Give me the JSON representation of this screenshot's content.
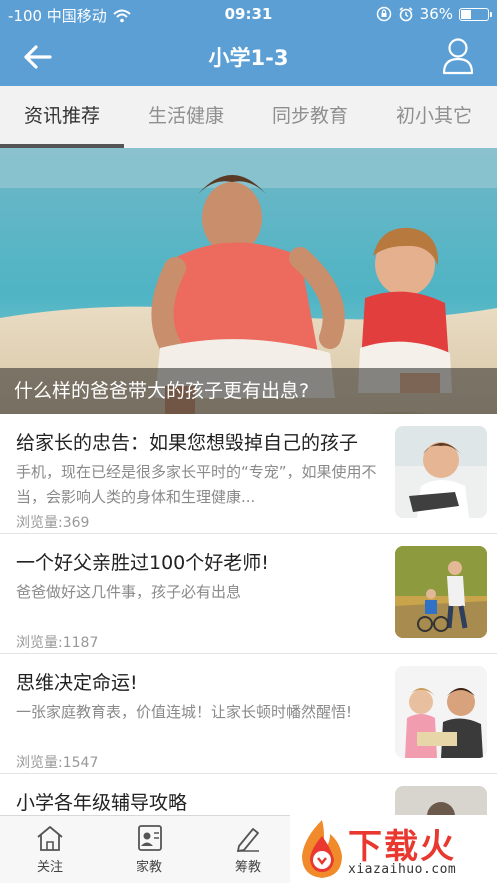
{
  "status_bar": {
    "carrier": "-100 中国移动",
    "time": "09:31",
    "battery": "36%",
    "battery_level": 0.36
  },
  "nav": {
    "title": "小学1-3",
    "back_icon": "arrow-left-icon",
    "user_icon": "user-icon"
  },
  "tabs": [
    {
      "label": "资讯推荐",
      "active": true
    },
    {
      "label": "生活健康",
      "active": false
    },
    {
      "label": "同步教育",
      "active": false
    },
    {
      "label": "初小其它",
      "active": false
    }
  ],
  "banner": {
    "caption": "什么样的爸爸带大的孩子更有出息?"
  },
  "news": [
    {
      "title": "给家长的忠告：如果您想毁掉自己的孩子",
      "summary": "手机，现在已经是很多家长平时的“专宠”，如果使用不当，会影响人类的身体和生理健康...",
      "views": "浏览量:369"
    },
    {
      "title": "一个好父亲胜过100个好老师!",
      "summary": "爸爸做好这几件事，孩子必有出息",
      "views": "浏览量:1187"
    },
    {
      "title": "思维决定命运!",
      "summary": "一张家庭教育表，价值连城！让家长顿时幡然醒悟!",
      "views": "浏览量:1547"
    },
    {
      "title": "小学各年级辅导攻略",
      "summary": "",
      "views": ""
    }
  ],
  "bottom_tabs": [
    {
      "label": "关注",
      "icon": "house-icon"
    },
    {
      "label": "家教",
      "icon": "contact-card-icon"
    },
    {
      "label": "筹教",
      "icon": "pencil-icon"
    }
  ],
  "watermark": {
    "text": "下载火",
    "url": "xiazaihuo.com"
  },
  "colors": {
    "nav_bg": "#5b9fd5",
    "tab_bg": "#f2f2f2",
    "watermark_red": "#e8382f"
  }
}
